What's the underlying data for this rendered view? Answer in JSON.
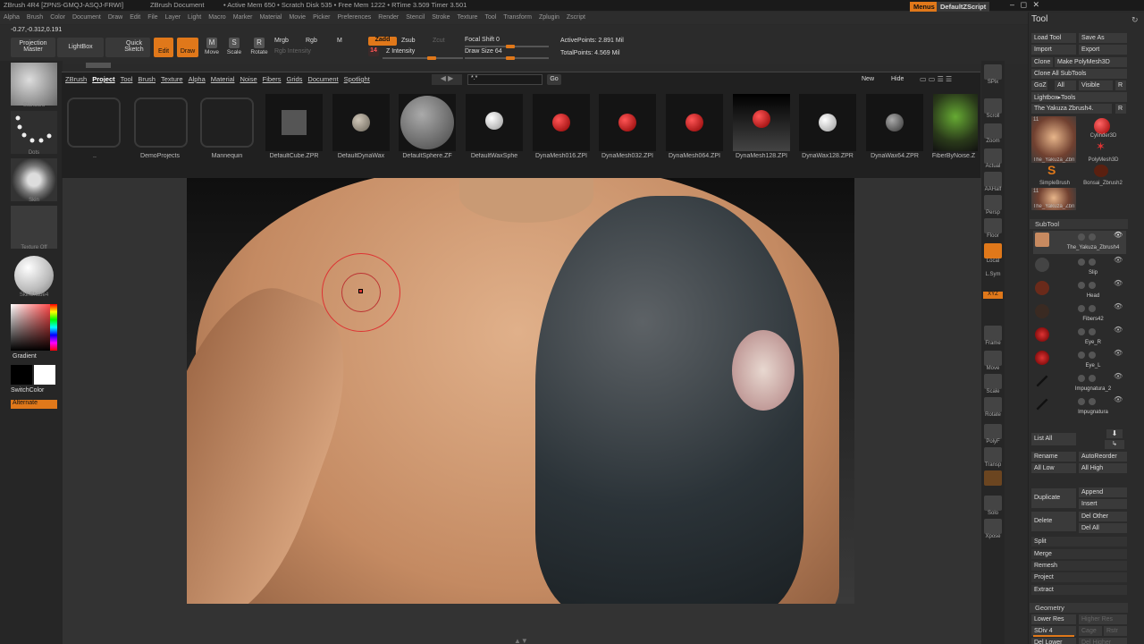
{
  "titlebar": {
    "app": "ZBrush 4R4 [ZPNS-GMQJ-ASQJ-FRWI]",
    "doc": "ZBrush Document",
    "status": "• Active Mem 650 • Scratch Disk 535 • Free Mem 1222 • RTime 3.509 Timer 3.501",
    "menus_label": "Menus",
    "script_label": "DefaultZScript"
  },
  "menubar": [
    "Alpha",
    "Brush",
    "Color",
    "Document",
    "Draw",
    "Edit",
    "File",
    "Layer",
    "Light",
    "Macro",
    "Marker",
    "Material",
    "Movie",
    "Picker",
    "Preferences",
    "Render",
    "Stencil",
    "Stroke",
    "Texture",
    "Tool",
    "Transform",
    "Zplugin",
    "Zscript"
  ],
  "coords": "-0.27,-0.312,0.191",
  "shelf": {
    "projection_master": "Projection Master",
    "lightbox": "LightBox",
    "quick_sketch": "Quick Sketch",
    "edit": "Edit",
    "draw": "Draw",
    "move": "Move",
    "scale": "Scale",
    "rotate": "Rotate",
    "mrgb": "Mrgb",
    "rgb": "Rgb",
    "m": "M",
    "rgb_intensity": "Rgb Intensity",
    "zadd": "Zadd",
    "zsub": "Zsub",
    "zcut": "Zcut",
    "z_value": "14",
    "z_intensity": "Z Intensity",
    "focal_shift": "Focal Shift 0",
    "draw_size": "Draw Size 64",
    "active_points": "ActivePoints: 2.891 Mil",
    "total_points": "TotalPoints: 4.569 Mil"
  },
  "leftpanel": {
    "standard": "Standard",
    "dots": "Dots",
    "skin": "Skin",
    "texture_off": "Texture Off",
    "skinshade": "SkinShade4",
    "gradient": "Gradient",
    "switchcolor": "SwitchColor",
    "alternate": "Alternate"
  },
  "project": {
    "tabs": [
      "ZBrush",
      "Project",
      "Tool",
      "Brush",
      "Texture",
      "Alpha",
      "Material",
      "Noise",
      "Fibers",
      "Grids",
      "Document",
      "Spotlight"
    ],
    "active_tab": "Project",
    "search_value": "*.*",
    "go": "Go",
    "new": "New",
    "hide": "Hide",
    "items": [
      "..",
      "DemoProjects",
      "Mannequin",
      "DefaultCube.ZPR",
      "DefaultDynaWax",
      "DefaultSphere.ZF",
      "DefaultWaxSphe",
      "DynaMesh016.ZPI",
      "DynaMesh032.ZPI",
      "DynaMesh064.ZPI",
      "DynaMesh128.ZPI",
      "DynaWax128.ZPR",
      "DynaWax64.ZPR",
      "FiberByNoise.Z"
    ]
  },
  "rightdock": [
    "SPix",
    "Scroll",
    "Zoom",
    "Actual",
    "AAHalf",
    "Persp",
    "Floor",
    "Local",
    "L.Sym",
    "XYZ",
    "Frame",
    "Move",
    "Scale",
    "Rotate",
    "PolyF",
    "Transp",
    "Solo",
    "Xpose"
  ],
  "toolpanel": {
    "title": "Tool",
    "load_tool": "Load Tool",
    "save_as": "Save As",
    "import": "Import",
    "export": "Export",
    "clone": "Clone",
    "make_polymesh": "Make PolyMesh3D",
    "clone_all": "Clone All SubTools",
    "goz": "GoZ",
    "all": "All",
    "visible": "Visible",
    "r": "R",
    "lightbox_tools": "Lightbox▸Tools",
    "current_tool": "The Yakuza Zbrush4.",
    "tool_thumbs": [
      "The_Yakuza_Zbri",
      "Cylinder3D",
      "PolyMesh3D",
      "SimpleBrush",
      "Bonsai_Zbrush2",
      "The_Yakuza_Zbri"
    ],
    "count_a": "11",
    "count_b": "11",
    "subtool_header": "SubTool",
    "subtools": [
      "The_Yakuza_Zbrush4",
      "Slip",
      "Head",
      "Fibers42",
      "Eye_R",
      "Eye_L",
      "Impugnatura_2",
      "Impugnatura"
    ],
    "list_all": "List All",
    "rename": "Rename",
    "autoreorder": "AutoReorder",
    "all_low": "All Low",
    "all_high": "All High",
    "duplicate": "Duplicate",
    "append": "Append",
    "insert": "Insert",
    "delete": "Delete",
    "del_other": "Del Other",
    "del_all": "Del All",
    "split": "Split",
    "merge": "Merge",
    "remesh": "Remesh",
    "project": "Project",
    "extract": "Extract",
    "geometry_header": "Geometry",
    "lower_res": "Lower Res",
    "higher_res": "Higher Res",
    "sdiv": "SDiv 4",
    "cage": "Cage",
    "rstr": "Rstr",
    "del_lower": "Del Lower",
    "del_higher": "Del Higher"
  },
  "colors": {
    "accent": "#e0781a",
    "bg": "#2a2a2a"
  }
}
